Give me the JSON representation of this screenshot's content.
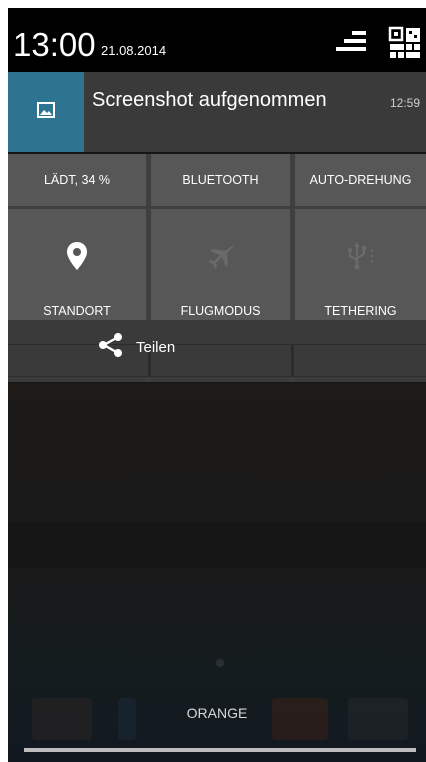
{
  "statusbar": {
    "time": "13:00",
    "date": "21.08.2014",
    "icons": [
      "signal-bars-icon",
      "settings-grid-icon"
    ]
  },
  "notification": {
    "icon": "image-icon",
    "title": "Screenshot aufgenommen",
    "time": "12:59",
    "accent_color": "#2e7390"
  },
  "quick_settings": {
    "tiles_row1": [
      {
        "label": "LÄDT, 34 %"
      },
      {
        "label": "BLUETOOTH"
      },
      {
        "label": "AUTO-DREHUNG"
      }
    ],
    "tiles_row2": [
      {
        "label": "STANDORT",
        "icon": "location-pin-icon"
      },
      {
        "label": "FLUGMODUS",
        "icon": "airplane-icon"
      },
      {
        "label": "TETHERING",
        "icon": "usb-icon"
      }
    ]
  },
  "share": {
    "label": "Teilen",
    "icon": "share-icon"
  },
  "homescreen": {
    "carrier": "ORANGE"
  }
}
